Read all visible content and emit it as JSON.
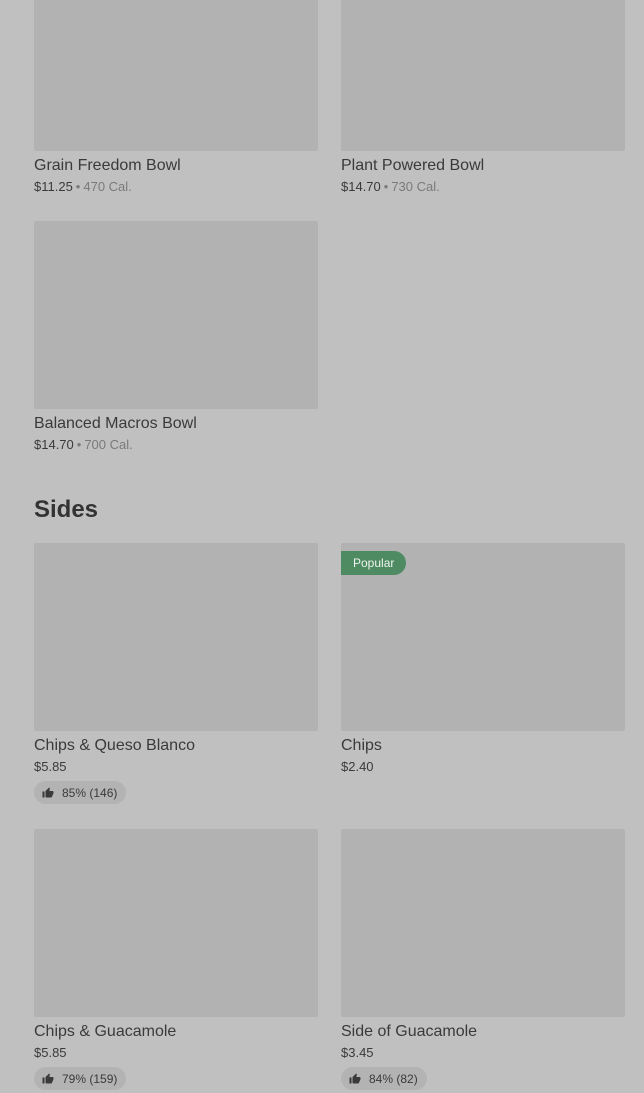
{
  "bowls": [
    {
      "name": "Grain Freedom Bowl",
      "price": "$11.25",
      "separator": "•",
      "calories": "470 Cal."
    },
    {
      "name": "Plant Powered Bowl",
      "price": "$14.70",
      "separator": "•",
      "calories": "730 Cal."
    },
    {
      "name": "Balanced Macros Bowl",
      "price": "$14.70",
      "separator": "•",
      "calories": "700 Cal."
    }
  ],
  "sides": {
    "title": "Sides",
    "items": [
      {
        "name": "Chips & Queso Blanco",
        "price": "$5.85",
        "rating": "85% (146)"
      },
      {
        "name": "Chips",
        "price": "$2.40",
        "badge": "Popular"
      },
      {
        "name": "Chips & Guacamole",
        "price": "$5.85",
        "rating": "79% (159)"
      },
      {
        "name": "Side of Guacamole",
        "price": "$3.45",
        "rating": "84% (82)"
      }
    ]
  },
  "icons": {
    "rating": "thumbs-up-icon"
  },
  "colors": {
    "background": "#c0c0c0",
    "image_placeholder": "#b2b2b2",
    "popular_badge": "#4e8a62",
    "rating_pill": "#b3b3b3"
  }
}
